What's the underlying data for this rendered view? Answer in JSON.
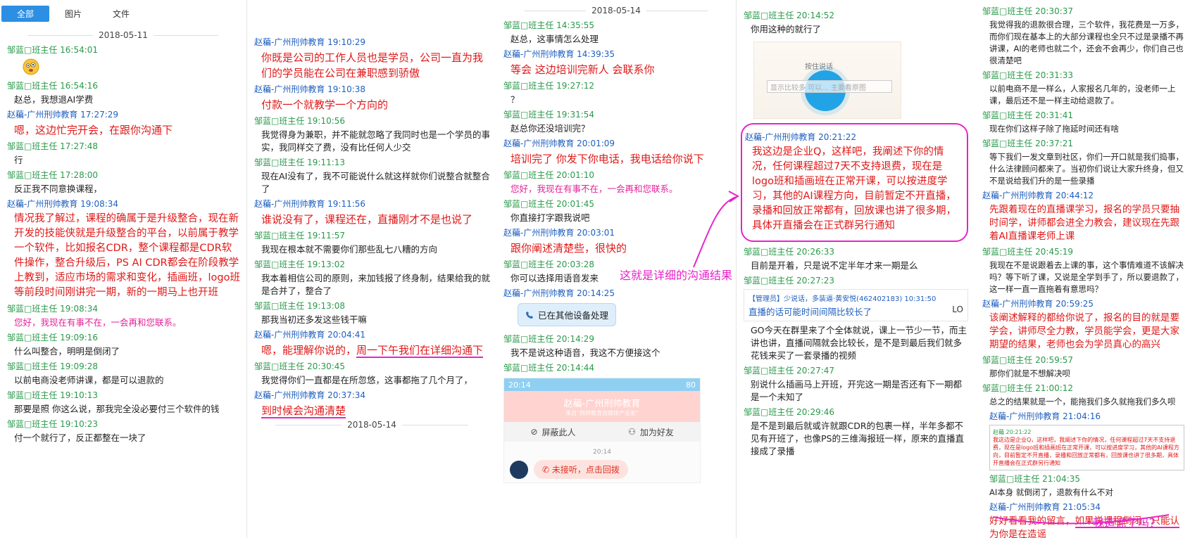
{
  "tabs": [
    "全部",
    "图片",
    "文件"
  ],
  "col1": {
    "date": "2018-05-11",
    "msgs": [
      {
        "meta": "邹蓝□班主任 16:54:01"
      },
      {
        "meta": "邹蓝□班主任 16:54:16",
        "text": "赵总，我想退AI学费"
      },
      {
        "meta": "赵藊-广州刑帅教育 17:27:29",
        "text": "嗯，这边忙完开会，在跟你沟通下"
      },
      {
        "meta": "邹蓝□班主任 17:27:48",
        "text": "行"
      },
      {
        "meta": "邹蓝□班主任 17:28:00",
        "text": "反正我不同意换课程，"
      },
      {
        "meta": "赵藊-广州刑帅教育 19:08:34",
        "text": "情况我了解过，课程的确属于是升级整合，现在新开发的技能侠就是升级整合的平台，以前属于教学一个软件，比如报名CDR，整个课程都是CDR软件操作，整合升级后，PS AI CDR都会在阶段教学上教到，适应市场的需求和变化，插画班，logo班等前段时间刚讲完一期，新的一期马上也开班"
      },
      {
        "meta": "邹蓝□班主任 19:08:34",
        "text": "您好，我现在有事不在，一会再和您联系。"
      },
      {
        "meta": "邹蓝□班主任 19:09:16",
        "text": "什么叫整合，明明是倒闭了"
      },
      {
        "meta": "邹蓝□班主任 19:09:28",
        "text": "以前电商没老师讲课，都是可以退款的"
      },
      {
        "meta": "邹蓝□班主任 19:10:13",
        "text": "那要是照 你这么说，那我完全没必要付三个软件的钱"
      },
      {
        "meta": "邹蓝□班主任 19:10:23",
        "text": "付一个就行了，反正都整在一块了"
      }
    ]
  },
  "col2": {
    "msgs": [
      {
        "meta": "赵藊-广州刑帅教育 19:10:29",
        "text": "你既是公司的工作人员也是学员，公司一直为我们的学员能在公司在兼职感到骄傲"
      },
      {
        "meta": "赵藊-广州刑帅教育 19:10:38",
        "text": "付款一个就教学一个方向的"
      },
      {
        "meta": "邹蓝□班主任 19:10:56",
        "text": "我觉得身为兼职，并不能就忽略了我同时也是一个学员的事实，我同样交了费，没有比任何人少交"
      },
      {
        "meta": "邹蓝□班主任 19:11:13",
        "text": "现在AI没有了，我不可能说什么就这样就你们说整合就整合了"
      },
      {
        "meta": "赵藊-广州刑帅教育 19:11:56",
        "text": "谁说没有了，课程还在，直播刚才不是也说了"
      },
      {
        "meta": "邹蓝□班主任 19:11:57",
        "text": "我现在根本就不需要你们那些乱七八糟的方向"
      },
      {
        "meta": "邹蓝□班主任 19:13:02",
        "text": "我本着相信公司的原则，来加钱报了终身制，结果给我的就是合并了，整合了"
      },
      {
        "meta": "邹蓝□班主任 19:13:08",
        "text": "那我当初还多发这些钱干嘛"
      },
      {
        "meta": "赵藊-广州刑帅教育 20:04:41",
        "text_a": "嗯，能理解你说的，",
        "text_b": "周一下午我们在详细沟通下"
      },
      {
        "meta": "邹蓝□班主任 20:30:45",
        "text": "我觉得你们一直都是在所忽悠，这事都拖了几个月了，"
      },
      {
        "meta": "赵藊-广州刑帅教育 20:37:34",
        "text": "到时候会沟通清楚"
      }
    ],
    "date_bottom": "2018-05-14"
  },
  "col3": {
    "date": "2018-05-14",
    "msgs": [
      {
        "meta": "邹蓝□班主任 14:35:55",
        "text": "赵总，这事情怎么处理"
      },
      {
        "meta": "赵藊-广州刑帅教育 14:39:35",
        "text": "等会 这边培训完新人  会联系你"
      },
      {
        "meta": "邹蓝□班主任 19:27:12",
        "text": "？"
      },
      {
        "meta": "邹蓝□班主任 19:31:54",
        "text": "赵总你还没培训完？"
      },
      {
        "meta": "赵藊-广州刑帅教育 20:01:09",
        "text": "培训完了 你发下你电话，我电话给你说下"
      },
      {
        "meta": "邹蓝□班主任 20:01:10",
        "text": "您好，我现在有事不在，一会再和您联系。"
      },
      {
        "meta": "邹蓝□班主任 20:01:45",
        "text": "你直接打字跟我说吧"
      },
      {
        "meta": "赵藊-广州刑帅教育 20:03:01",
        "text": "跟你阐述清楚些，很快的"
      },
      {
        "meta": "邹蓝□班主任 20:03:28",
        "text": "你可以选择用语音发来"
      },
      {
        "meta": "赵藊-广州刑帅教育 20:14:25",
        "call": "已在其他设备处理"
      },
      {
        "meta": "邹蓝□班主任 20:14:29",
        "text": "我不是说这种语音，我这不方便接这个"
      },
      {
        "meta": "邹蓝□班主任 20:14:44"
      }
    ],
    "phone": {
      "status": "20:14",
      "battery": "80",
      "title": "赵藊-广州刑帅教育",
      "subtitle": "来自\"刑帅教育自媒体产业家\"",
      "block": "屏蔽此人",
      "add": "加为好友",
      "time": "20:14",
      "missed": "未接听，点击回拨"
    }
  },
  "col4": {
    "msgs_top": [
      {
        "meta": "邹蓝□班主任 20:14:52",
        "text": "你用这种的就行了"
      }
    ],
    "voice": {
      "title": "按住说话",
      "placeholder": "显示比较多 可以... 主要看原图"
    },
    "box": {
      "meta": "赵藊-广州刑帅教育 20:21:22",
      "text": "我这边是企业Q，这样吧，我阐述下你的情况，任何课程超过7天不支持退费，现在是logo班和插画班在正常开课，可以按进度学习，其他的AI课程方向，目前暂定不开直播，录播和回放正常都有，回放课也讲了很多期，具体开直播会在正式群另行通知"
    },
    "msgs": [
      {
        "meta": "邹蓝□班主任 20:26:33",
        "text": "目前是开着，只是说不定半年才来一期是么"
      },
      {
        "meta": "邹蓝□班主任 20:27:23"
      }
    ],
    "notice": {
      "meta": "【管理员】少说话，多装逼·黄安悦(462402183) 10:31:50",
      "text": "直播的话可能时间间隔比较长了",
      "tail": "LO"
    },
    "msgs2": [
      {
        "text": "GO今天在群里来了个全体就说，课上一节少一节，而主讲也讲，直播间隔就会比较长，是不是到最后我们就多花钱来买了一套录播的视频"
      },
      {
        "meta": "邹蓝□班主任 20:27:47",
        "text": "别说什么插画马上开班，开完这一期是否还有下一期都是一个未知了"
      },
      {
        "meta": "邹蓝□班主任 20:29:46",
        "text": "是不是到最后就或许就跟CDR的包裹一样，半年多都不见有开班了，也像PS的三维海报班一样，原来的直播直接成了录播"
      }
    ]
  },
  "col5": {
    "msgs": [
      {
        "meta": "邹蓝□班主任 20:30:37",
        "text": "我觉得我的退款很合理，三个软件，我花费是一万多，而你们现在基本上的大部分课程也全只不过是录播不再讲课，AI的老师也就二个，还会不会再少，你们自己也很清楚吧"
      },
      {
        "meta": "邹蓝□班主任 20:31:33",
        "text": "以前电商不是一样么，人家报名几年的，没老师一上课，最后还不是一样主动给退款了。"
      },
      {
        "meta": "邹蓝□班主任 20:31:41",
        "text": "现在你们这样子除了拖延时间还有啥"
      },
      {
        "meta": "邹蓝□班主任 20:37:21",
        "text": "等下我们一发文章到社区，你们一开口就是我们捣事，什么法律顾问都来了。当初你们说让大家升终身，但又不是说给我们升的是一些录播"
      },
      {
        "meta": "赵藊-广州刑帅教育 20:44:12",
        "text": "先跟着现在的直播课学习，报名的学员只要抽时间学，讲师都会进全力教会，建议现在先跟着AI直播课老师上课",
        "red": true
      },
      {
        "meta": "邹蓝□班主任 20:45:19",
        "text": "我现在不是说跟着去上课的事，这个事情难道不该解决吗？等下听了课，又说是全学到手了，所以要退款了，这一样一直一直拖着有意思吗？"
      },
      {
        "meta": "赵藊-广州刑帅教育 20:59:25",
        "text": "该阐述解释的都给你说了，报名的目的就是要学会，讲师尽全力教，学员能学会，更是大家期望的结果，老师也会为学员真心的高兴",
        "red": true
      },
      {
        "meta": "邹蓝□班主任 20:59:57",
        "text": "那你们就是不想解决呗"
      },
      {
        "meta": "邹蓝□班主任 21:00:12",
        "text": "总之的结果就是一个，能拖我们多久就拖我们多久呗"
      },
      {
        "meta": "赵藊-广州刑帅教育 21:04:16"
      },
      {
        "meta": "邹蓝□班主任 21:04:35",
        "text": "AI本身 就倒闭了，退款有什么不对"
      },
      {
        "meta": "赵藊-广州刑帅教育 21:05:34",
        "text_a": "好好看看我的留言，",
        "text_b": "如果说课程倒闭，只能认为你是在造谣"
      }
    ],
    "quote": {
      "meta": "赵藊 20:21:22",
      "text": "我这边是企业Q，这样吧，我阐述下你的情况，任何课程超过7天不支持退费，现在是logo班和插画班在正常开课，可以按进度学习，其他的AI课程方向，目前暂定不开直播，录播和回放正常都有，回放课也讲了很多期，具体开直播会在正式群另行通知"
    }
  },
  "annotations": {
    "detail": "这就是详细的沟通结果",
    "rumor": "我造谣了吗？"
  },
  "colors": {
    "staff": "#2a9a4a",
    "me": "#1f5fbf",
    "red": "#e01818",
    "highlight": "#e624c8",
    "tab": "#2c8fe3"
  }
}
